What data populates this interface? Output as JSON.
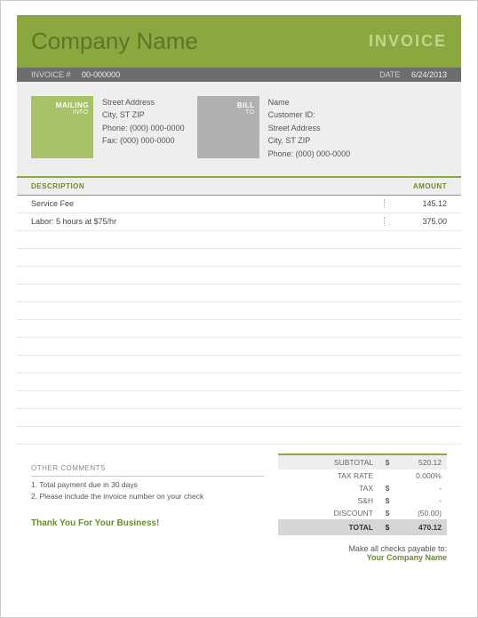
{
  "header": {
    "company": "Company Name",
    "title": "INVOICE"
  },
  "meta": {
    "invoice_label": "INVOICE #",
    "invoice_num": "00-000000",
    "date_label": "DATE",
    "date": "6/24/2013"
  },
  "mailing": {
    "label": "MAILING",
    "sub": "INFO",
    "lines": [
      "Street Address",
      "City, ST  ZIP",
      "Phone: (000) 000-0000",
      "Fax: (000) 000-0000"
    ]
  },
  "bill": {
    "label": "BILL",
    "sub": "TO",
    "lines": [
      "Name",
      "Customer ID:",
      "Street Address",
      "City, ST  ZIP",
      "Phone: (000) 000-0000"
    ]
  },
  "table": {
    "head_desc": "DESCRIPTION",
    "head_amt": "AMOUNT",
    "rows": [
      {
        "desc": "Service Fee",
        "amt": "145.12"
      },
      {
        "desc": "Labor: 5 hours at $75/hr",
        "amt": "375.00"
      },
      {
        "desc": "",
        "amt": ""
      },
      {
        "desc": "",
        "amt": ""
      },
      {
        "desc": "",
        "amt": ""
      },
      {
        "desc": "",
        "amt": ""
      },
      {
        "desc": "",
        "amt": ""
      },
      {
        "desc": "",
        "amt": ""
      },
      {
        "desc": "",
        "amt": ""
      },
      {
        "desc": "",
        "amt": ""
      },
      {
        "desc": "",
        "amt": ""
      },
      {
        "desc": "",
        "amt": ""
      },
      {
        "desc": "",
        "amt": ""
      },
      {
        "desc": "",
        "amt": ""
      }
    ]
  },
  "comments": {
    "title": "OTHER COMMENTS",
    "lines": [
      "1. Total payment due in 30 days",
      "2. Please include the invoice number on your check"
    ]
  },
  "totals": {
    "rows": [
      {
        "lbl": "SUBTOTAL",
        "cur": "$",
        "val": "520.12",
        "cls": "subtotal"
      },
      {
        "lbl": "TAX RATE",
        "cur": "",
        "val": "0.000%",
        "cls": ""
      },
      {
        "lbl": "TAX",
        "cur": "$",
        "val": "-",
        "cls": ""
      },
      {
        "lbl": "S&H",
        "cur": "$",
        "val": "-",
        "cls": ""
      },
      {
        "lbl": "DISCOUNT",
        "cur": "$",
        "val": "(50.00)",
        "cls": ""
      },
      {
        "lbl": "TOTAL",
        "cur": "$",
        "val": "470.12",
        "cls": "total"
      }
    ]
  },
  "payable": {
    "text": "Make all checks payable to:",
    "name": "Your Company Name"
  },
  "thanks": "Thank You For Your Business!"
}
